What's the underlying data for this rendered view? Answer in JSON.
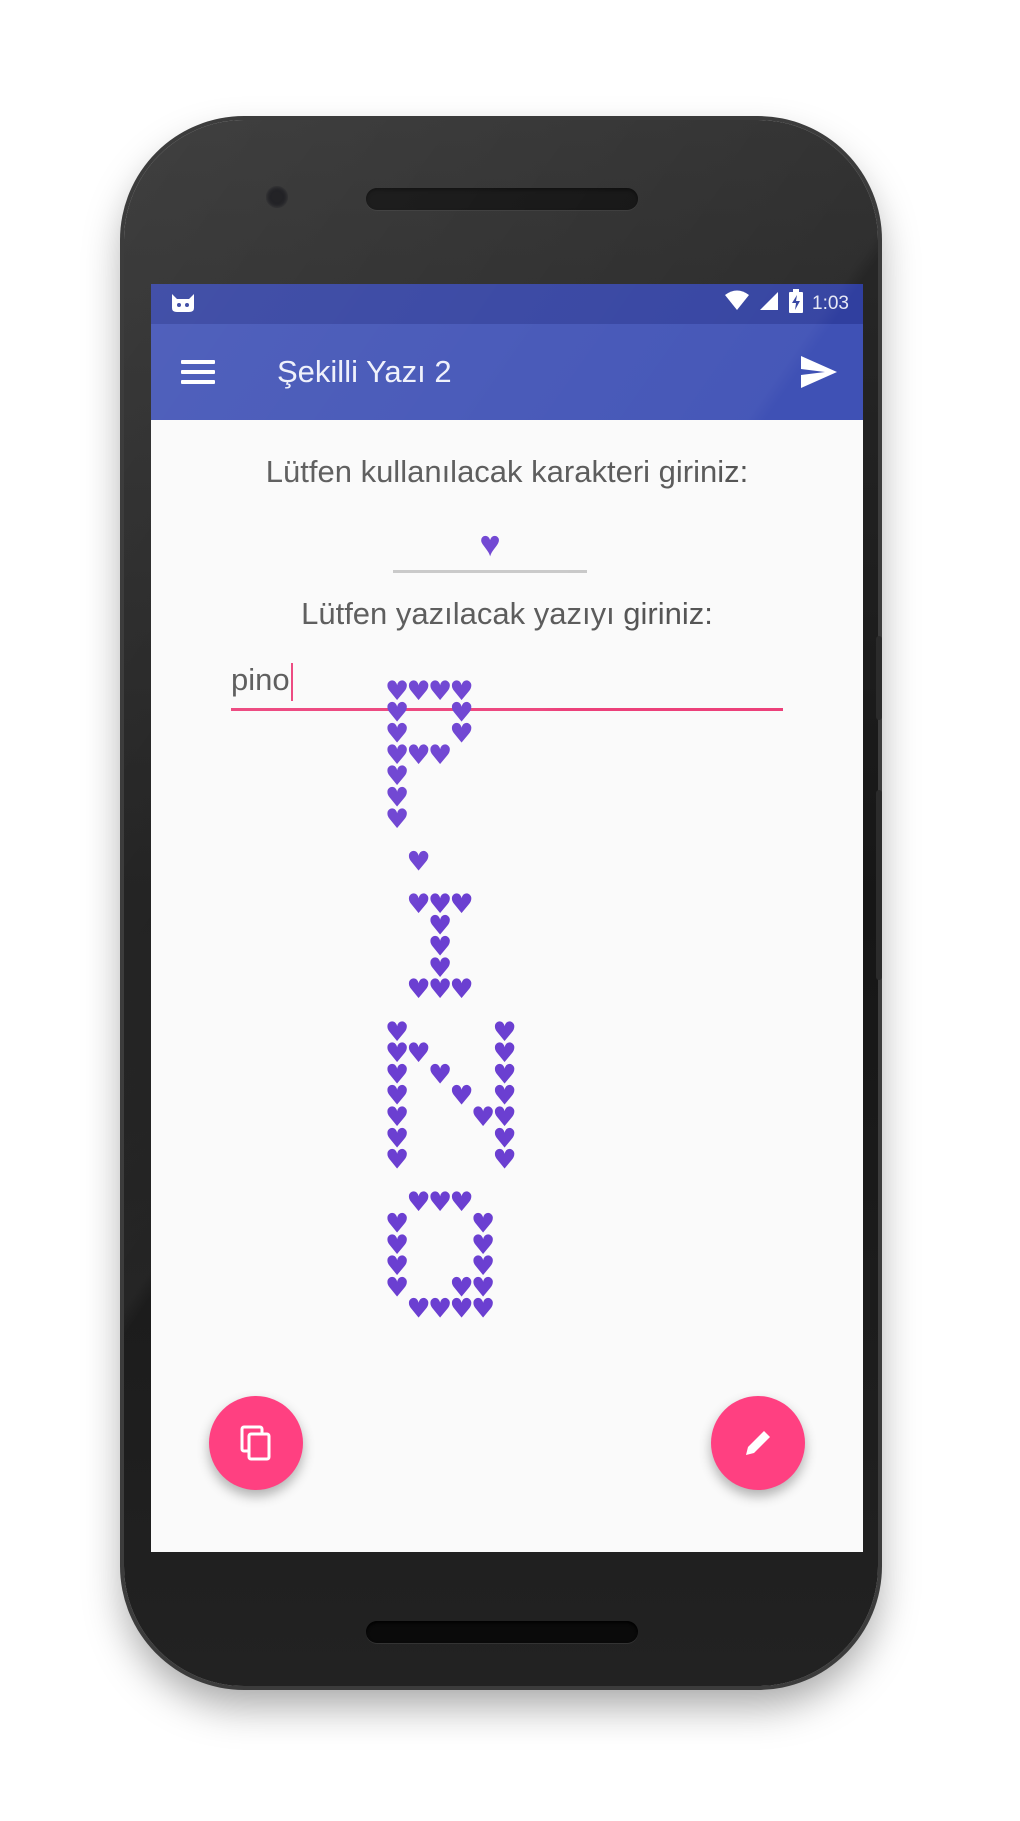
{
  "statusbar": {
    "time": "1:03"
  },
  "appbar": {
    "title": "Şekilli Yazı 2"
  },
  "form": {
    "char_label": "Lütfen kullanılacak karakteri giriniz:",
    "char_value": "♥",
    "text_label": "Lütfen yazılacak yazıyı giriniz:",
    "text_value": "pino"
  },
  "output": {
    "glyph": "♥",
    "lines": [
      "♥♥♥♥",
      "♥  ♥",
      "♥  ♥",
      "♥♥♥",
      "♥",
      "♥",
      "♥",
      "",
      " ♥",
      "",
      " ♥♥♥",
      "  ♥",
      "  ♥",
      "  ♥",
      " ♥♥♥",
      "",
      "♥    ♥",
      "♥♥   ♥",
      "♥ ♥  ♥",
      "♥  ♥ ♥",
      "♥   ♥♥",
      "♥    ♥",
      "♥    ♥",
      "",
      " ♥♥♥",
      "♥   ♥",
      "♥   ♥",
      "♥   ♥",
      "♥  ♥♥",
      " ♥♥♥♥"
    ]
  },
  "colors": {
    "status_bar": "#303f9f",
    "app_bar": "#3f51b5",
    "accent": "#ff4081",
    "heart": "#6b3fd1"
  },
  "icons": {
    "status_left": "cat-icon",
    "wifi": "wifi-icon",
    "signal": "signal-icon",
    "battery": "battery-charging-icon",
    "menu": "hamburger-menu-icon",
    "send": "send-icon",
    "copy_fab": "copy-icon",
    "edit_fab": "pencil-icon"
  }
}
